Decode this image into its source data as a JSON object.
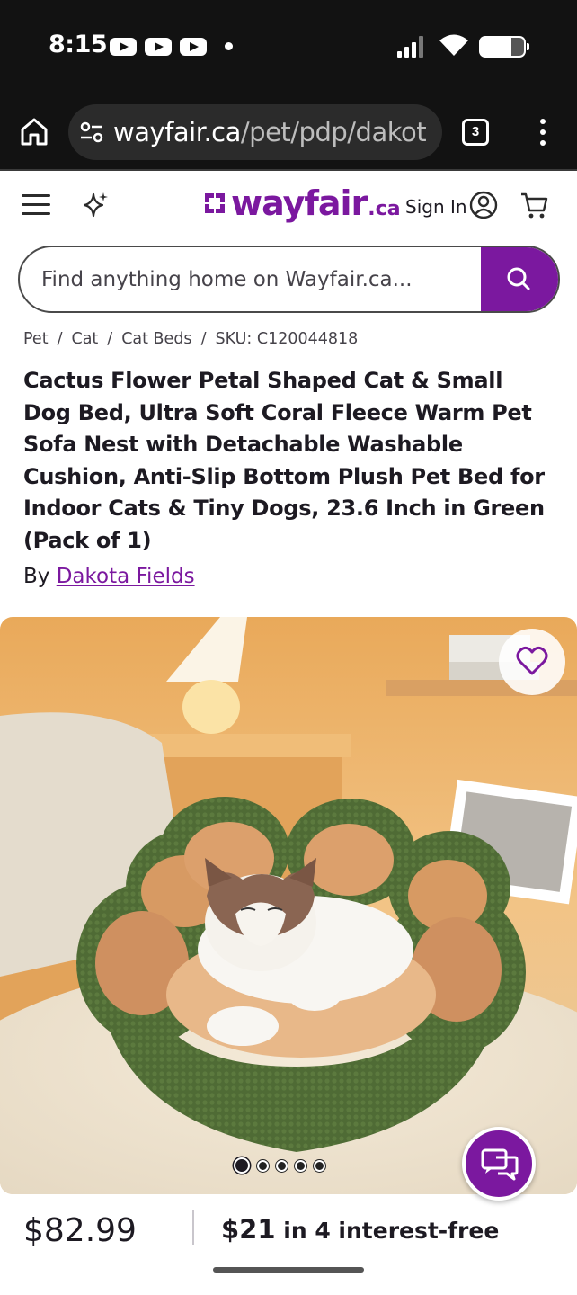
{
  "status_bar": {
    "time": "8:15",
    "tab_count": "3"
  },
  "browser": {
    "url_domain": "wayfair.ca",
    "url_path": "/pet/pdp/dakot"
  },
  "header": {
    "logo_text": "wayfair",
    "logo_suffix": ".ca",
    "sign_in_label": "Sign In",
    "brand_color": "#7b189f"
  },
  "search": {
    "placeholder": "Find anything home on Wayfair.ca..."
  },
  "breadcrumb": {
    "items": [
      "Pet",
      "Cat",
      "Cat Beds"
    ],
    "sku": "SKU: C120044818"
  },
  "product": {
    "title": "Cactus Flower Petal Shaped Cat & Small Dog Bed, Ultra Soft Coral Fleece Warm Pet Sofa Nest with Detachable Washable Cushion, Anti-Slip Bottom Plush Pet Bed for Indoor Cats & Tiny Dogs, 23.6 Inch in Green (Pack of 1)",
    "by_label": "By",
    "brand": "Dakota Fields",
    "image_count": 5,
    "active_image": 1,
    "price": "$82.99",
    "financing_amount": "$21",
    "financing_text": " in 4 interest-free"
  }
}
